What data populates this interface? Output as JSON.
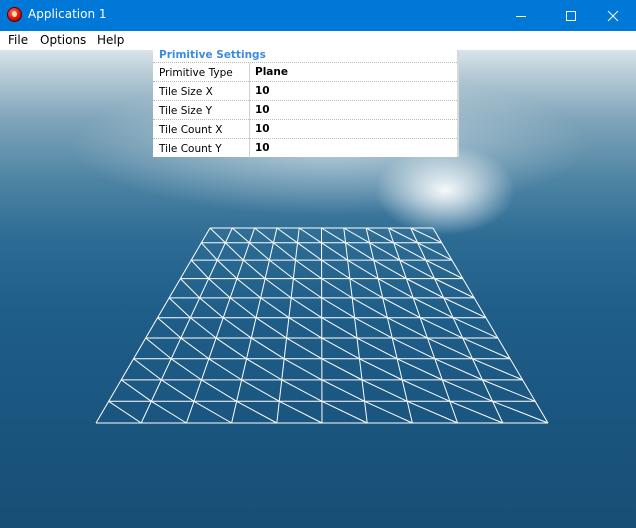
{
  "window": {
    "title": "Application 1",
    "controls": {
      "minimize_icon": "minimize-icon",
      "maximize_icon": "maximize-icon",
      "close_icon": "close-icon"
    }
  },
  "menu": {
    "items": [
      "File",
      "Options",
      "Help"
    ]
  },
  "settings_panel": {
    "title": "Primitive Settings",
    "rows": [
      {
        "label": "Primitive Type",
        "value": "Plane"
      },
      {
        "label": "Tile Size X",
        "value": "10"
      },
      {
        "label": "Tile Size Y",
        "value": "10"
      },
      {
        "label": "Tile Count X",
        "value": "10"
      },
      {
        "label": "Tile Count Y",
        "value": "10"
      }
    ]
  },
  "colors": {
    "titlebar": "#0078d7",
    "panel_title": "#3c8be0",
    "wireframe": "#ffffff"
  }
}
